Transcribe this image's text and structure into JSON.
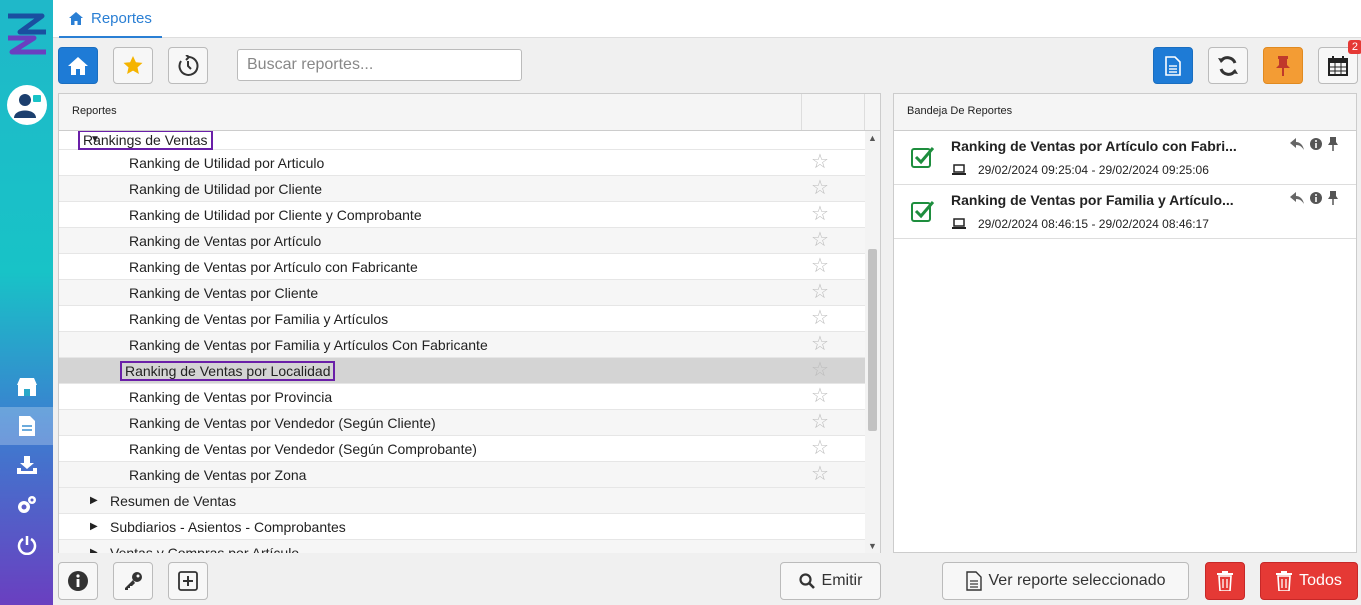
{
  "header": {
    "tab_label": "Reportes"
  },
  "toolbar": {
    "search_placeholder": "Buscar reportes...",
    "calendar_badge": "2"
  },
  "left_panel": {
    "header": "Reportes",
    "open_group": "Rankings de Ventas",
    "items": [
      "Ranking de Utilidad por Articulo",
      "Ranking de Utilidad por Cliente",
      "Ranking de Utilidad por Cliente y Comprobante",
      "Ranking de Ventas por Artículo",
      "Ranking de Ventas por Artículo con Fabricante",
      "Ranking de Ventas por Cliente",
      "Ranking de Ventas por Familia y Artículos",
      "Ranking de Ventas por Familia y Artículos Con Fabricante",
      "Ranking de Ventas por Localidad",
      "Ranking de Ventas por Provincia",
      "Ranking de Ventas por Vendedor (Según Cliente)",
      "Ranking de Ventas por Vendedor (Según Comprobante)",
      "Ranking de Ventas por Zona"
    ],
    "collapsed_groups": [
      "Resumen de Ventas",
      "Subdiarios - Asientos - Comprobantes",
      "Ventas y Compras por Artículo"
    ]
  },
  "right_panel": {
    "header": "Bandeja De Reportes",
    "items": [
      {
        "title": "Ranking de Ventas por Artículo con Fabri...",
        "dates": "29/02/2024 09:25:04 - 29/02/2024 09:25:06"
      },
      {
        "title": "Ranking de Ventas por Familia y Artículo...",
        "dates": "29/02/2024 08:46:15 - 29/02/2024 08:46:17"
      }
    ]
  },
  "bottom": {
    "emitir_label": "Emitir",
    "ver_reporte_label": "Ver reporte seleccionado",
    "todos_label": "Todos"
  },
  "colors": {
    "accent": "#1e7bd6",
    "danger": "#e53935",
    "pin": "#f39c34",
    "highlight_border": "#6a1fa8"
  }
}
